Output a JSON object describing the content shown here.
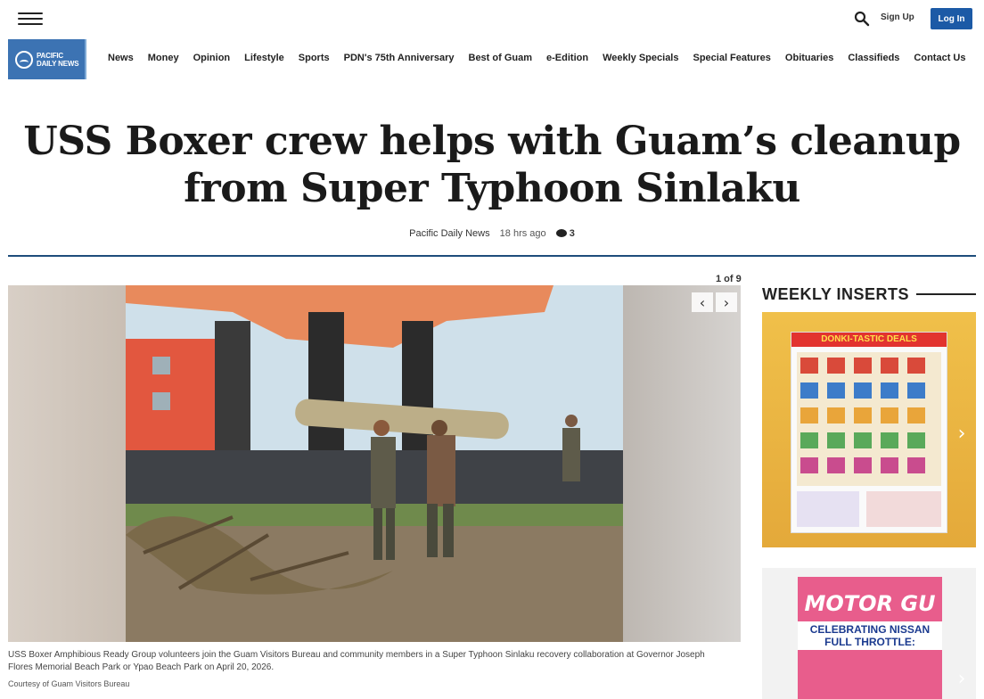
{
  "header": {
    "signup_label": "Sign Up",
    "login_label": "Log In"
  },
  "brand": {
    "logo_line1": "PACIFIC",
    "logo_line2": "DAILY NEWS",
    "accent_color": "#1c5aa6"
  },
  "nav": {
    "items": [
      "News",
      "Money",
      "Opinion",
      "Lifestyle",
      "Sports",
      "PDN's 75th Anniversary",
      "Best of Guam",
      "e-Edition",
      "Weekly Specials",
      "Special Features",
      "Obituaries",
      "Classifieds",
      "Contact Us"
    ]
  },
  "article": {
    "title": "USS Boxer crew helps with Guam’s cleanup from Super Typhoon Sinlaku",
    "author": "Pacific Daily News",
    "time": "18 hrs ago",
    "comment_count": "3"
  },
  "gallery": {
    "counter": "1 of 9",
    "caption": "USS Boxer Amphibious Ready Group volunteers join the Guam Visitors Bureau and community members in a Super Typhoon Sinlaku recovery collaboration at Governor Joseph Flores Memorial Beach Park or Ypao Beach Park on April 20, 2026.",
    "credit": "Courtesy of Guam Visitors Bureau",
    "prev_icon": "chevron-left-icon",
    "next_icon": "chevron-right-icon"
  },
  "sidebar": {
    "title": "WEEKLY INSERTS",
    "inserts": [
      {
        "headline": "DONKI-TASTIC DEALS"
      },
      {
        "headline": "MOTOR GU",
        "subline": "CELEBRATING NISSAN FULL THROTTLE:"
      }
    ]
  }
}
